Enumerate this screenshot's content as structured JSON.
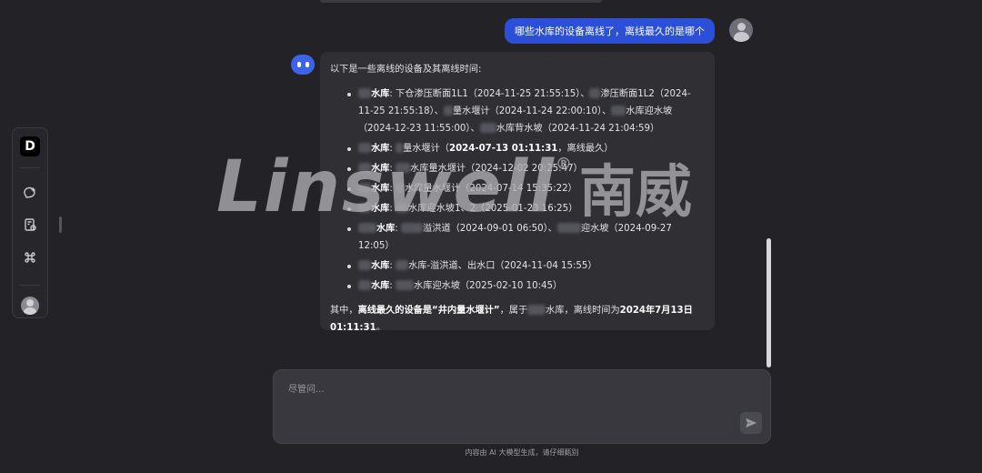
{
  "rail": {
    "logo_letter": "D",
    "items": [
      "new-chat-icon",
      "history-icon",
      "apps-icon"
    ]
  },
  "conversation": {
    "user_message": "哪些水库的设备离线了，离线最久的是哪个",
    "answer": {
      "intro": "以下是一些离线的设备及其离线时间:",
      "items": [
        {
          "reservoir": "水库",
          "details": "下仓渗压断面1L1（2024-11-25 21:55:15）、",
          "details2": "渗压断面1L2（2024-11-25 21:55:18）、",
          "details3": "量水堰计（2024-11-24 22:00:10）、",
          "details4": "水库迎水坡（2024-12-23 11:55:00）、",
          "details5": "水库背水坡（2024-11-24 21:04:59）"
        },
        {
          "reservoir": "水库",
          "details_pre": "量水堰计（",
          "bold": "2024-07-13 01:11:31",
          "details_post": "，离线最久）"
        },
        {
          "reservoir": "水库",
          "details": "水库量水堰计（2024-12-02 20:25:47）"
        },
        {
          "reservoir": "水库",
          "details": "水库量水堰计（2024-07-14 15:35:22）"
        },
        {
          "reservoir": "水库",
          "details": "水库迎水坡1、2（2025-01-23 16:25）"
        },
        {
          "reservoir": "水库",
          "details": "溢洪道（2024-09-01 06:50）、",
          "details2": "迎水坡（2024-09-27 12:05）"
        },
        {
          "reservoir": "水库",
          "details": "水库-溢洪道、出水口（2024-11-04 15:55）"
        },
        {
          "reservoir": "水库",
          "details": "水库迎水坡（2025-02-10 10:45）"
        }
      ],
      "summary_pre": "其中，",
      "summary_bold1": "离线最久的设备是“井内量水堰计”",
      "summary_mid": "，属于",
      "summary_mid2": "水库，离线时间为",
      "summary_bold2": "2024年7月13日 01:11:31",
      "summary_end": "。"
    }
  },
  "watermark": {
    "latin": "Linswell",
    "mark": "®",
    "cn": "南威"
  },
  "composer": {
    "placeholder": "尽管问...",
    "disclaimer": "内容由 AI 大模型生成，请仔细甄别"
  }
}
